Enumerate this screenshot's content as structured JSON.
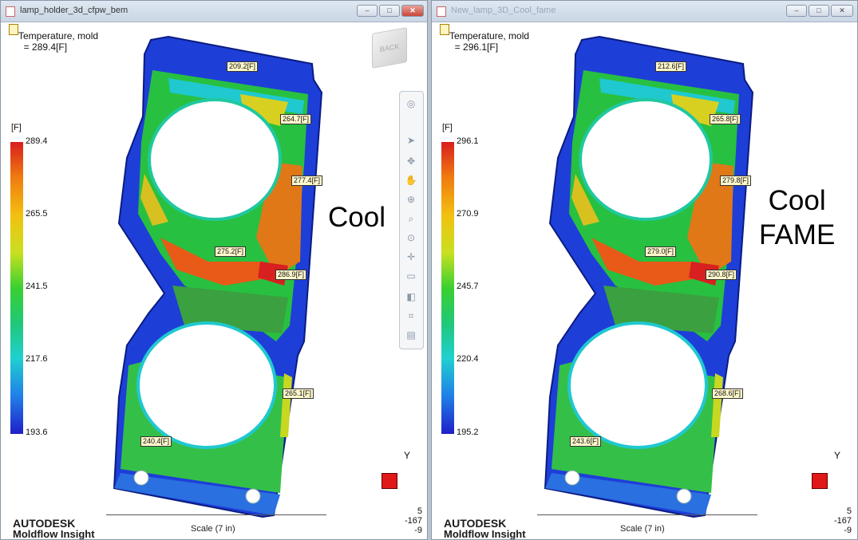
{
  "windows": [
    {
      "title": "lamp_holder_3d_cfpw_bem",
      "result_name": "Temperature, mold",
      "result_value": "= 289.4[F]",
      "unit": "[F]",
      "scale_ticks": [
        "289.4",
        "265.5",
        "241.5",
        "217.6",
        "193.6"
      ],
      "probes": [
        "209.2[F]",
        "264.7[F]",
        "277.4[F]",
        "275.2[F]",
        "286.9[F]",
        "265.1[F]",
        "240.4[F]"
      ],
      "annotation": "Cool",
      "viewcube_label": "BACK",
      "axis_label": "Y",
      "brand_line1": "AUTODESK",
      "brand_line2": "Moldflow Insight",
      "scale_label": "Scale (7 in)",
      "coords": "5\n-167\n-9"
    },
    {
      "title": "New_lamp_3D_Cool_fame",
      "result_name": "Temperature, mold",
      "result_value": "= 296.1[F]",
      "unit": "[F]",
      "scale_ticks": [
        "296.1",
        "270.9",
        "245.7",
        "220.4",
        "195.2"
      ],
      "probes": [
        "212.6[F]",
        "265.8[F]",
        "279.8[F]",
        "279.0[F]",
        "290.8[F]",
        "268.6[F]",
        "243.6[F]"
      ],
      "annotation": "Cool\nFAME",
      "axis_label": "Y",
      "brand_line1": "AUTODESK",
      "brand_line2": "Moldflow Insight",
      "scale_label": "Scale (7 in)",
      "coords": "5\n-167\n-9"
    }
  ],
  "colors": {
    "scale_max": "#d81e1e",
    "scale_mid": "#3ad030",
    "scale_min": "#1f1fc8",
    "part_blue": "#1e3ed8",
    "probe_bg": "#fff8cc"
  },
  "window_controls": [
    "minimize",
    "maximize",
    "close"
  ]
}
